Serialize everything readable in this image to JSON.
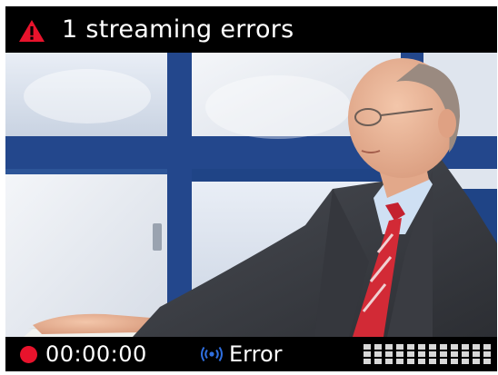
{
  "header": {
    "error_title": "1 streaming errors",
    "warning_icon": "warning-triangle-icon",
    "warning_color": "#e8132c"
  },
  "video": {
    "content": "live-video-frame"
  },
  "footer": {
    "record_indicator_icon": "record-dot-icon",
    "record_color": "#e8132c",
    "timecode": "00:00:00",
    "stream_icon": "broadcast-signal-icon",
    "stream_icon_color": "#2f6fe0",
    "stream_status": "Error",
    "audio_meter_icon": "audio-level-meter-icon"
  }
}
